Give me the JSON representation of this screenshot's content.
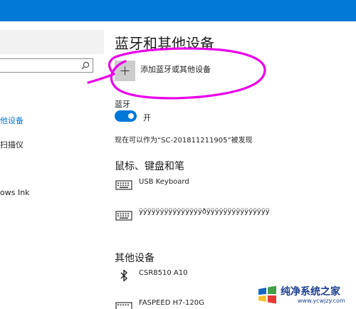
{
  "colors": {
    "accent": "#0078d7",
    "annotation": "#e800e8"
  },
  "sidebar": {
    "items": [
      {
        "label": "他设备"
      },
      {
        "label": "扫描仪"
      },
      {
        "label": "ows Ink"
      }
    ]
  },
  "main": {
    "title": "蓝牙和其他设备",
    "add_device_label": "添加蓝牙或其他设备",
    "bluetooth": {
      "label": "蓝牙",
      "state": "开",
      "discoverable_text": "现在可以作为“SC-201811211905”被发现"
    },
    "sections": {
      "mouse_keyboard_pen": "鼠标、键盘和笔",
      "other_devices": "其他设备"
    },
    "devices": {
      "keyboard_1": "USB Keyboard",
      "keyboard_2": "ÿÿÿÿÿÿÿÿÿÿÿÿÿÿÿðÿÿÿÿÿÿÿÿÿÿÿÿÿÿÿ",
      "bluetooth_device": "CSR8510 A10",
      "drive_device": "FASPEED H7-120G"
    }
  },
  "watermark": {
    "text": "纯净系统之家",
    "url": "www.ycwjzy.com"
  }
}
